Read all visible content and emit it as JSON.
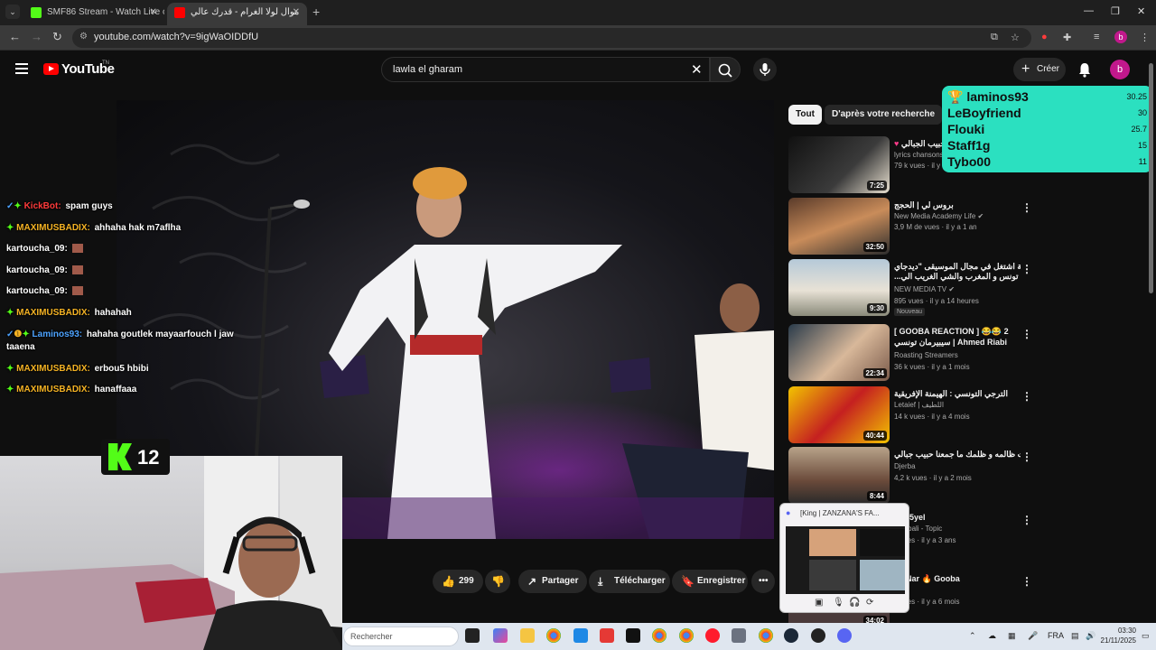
{
  "browser": {
    "tabs": [
      {
        "title": "SMF86 Stream - Watch Live on",
        "active": false
      },
      {
        "title": "موال لولا الغرام - قدرك عالي",
        "active": true
      }
    ],
    "url": "youtube.com/watch?v=9igWaOIDDfU",
    "profile_initial": "b"
  },
  "youtube": {
    "logo_text": "YouTube",
    "logo_tm": "TN",
    "search_query": "lawla el gharam",
    "create_label": "Créer",
    "avatar_initial": "b",
    "chips": [
      "Tout",
      "D'après votre recherche"
    ],
    "actions": {
      "likes": "299",
      "share": "Partager",
      "download": "Télécharger",
      "save": "Enregistrer"
    }
  },
  "chat": {
    "messages": [
      {
        "user": "KickBot:",
        "text": "spam guys",
        "color": "#ff3b3b"
      },
      {
        "user": "MAXIMUSBADIX:",
        "text": "ahhaha hak m7aflha",
        "color": "#f5b324"
      },
      {
        "user": "kartoucha_09:",
        "text": "",
        "color": "#ffffff"
      },
      {
        "user": "kartoucha_09:",
        "text": "",
        "color": "#ffffff"
      },
      {
        "user": "kartoucha_09:",
        "text": "",
        "color": "#ffffff"
      },
      {
        "user": "MAXIMUSBADIX:",
        "text": "hahahah",
        "color": "#f5b324"
      },
      {
        "user": "Laminos93:",
        "text": "hahaha goutlek mayaarfouch l jaw",
        "text2": "taaena",
        "color": "#4da3ff"
      },
      {
        "user": "MAXIMUSBADIX:",
        "text": "erbou5 hbibi",
        "color": "#f5b324"
      },
      {
        "user": "MAXIMUSBADIX:",
        "text": "hanaffaaa",
        "color": "#f5b324"
      }
    ],
    "viewer_count": "12"
  },
  "leaderboard": [
    {
      "name": "laminos93",
      "score": "30.25"
    },
    {
      "name": "LeBoyfriend",
      "score": "30"
    },
    {
      "name": "Flouki",
      "score": "25.7"
    },
    {
      "name": "Staff1g",
      "score": "15"
    },
    {
      "name": "Tybo00",
      "score": "11"
    }
  ],
  "recommendations": [
    {
      "title": "حبيب الجبالي",
      "channel": "lyrics chansons",
      "meta": "79 k vues · il y",
      "duration": "7:25"
    },
    {
      "title": "بروس لي | الحجج",
      "channel": "New Media Academy Life",
      "meta": "3,9 M de vues · il y a 1 an",
      "duration": "32:50"
    },
    {
      "title": "جزائرية اشتغل في مجال الموسيقى \"ديدجاي\"",
      "title2": "...عملت في تونس و المغرب والشي الغريب الي",
      "channel": "NEW MEDIA TV",
      "meta": "895 vues · il y a 14 heures",
      "badge": "Nouveau",
      "duration": "9:30"
    },
    {
      "title": "[ GOOBA REACTION ] 😂😂 2",
      "title2": "سيبيرمان تونسي | Ahmed Riabi",
      "channel": "Roasting Streamers",
      "meta": "36 k vues · il y a 1 mois",
      "duration": "22:34"
    },
    {
      "title": "الترجي التونسي : الهيمنة الإفريقية",
      "channel": "Letaief | اللطيف",
      "meta": "14 k vues · il y a 4 mois",
      "duration": "40:44"
    },
    {
      "title": "أنت ظالمه و ظلمك ما جمعنا حبيب جبالي",
      "channel": "Djerba",
      "meta": "4,2 k vues · il y a 2 mois",
      "duration": "8:44"
    },
    {
      "title": "Rat 5yel",
      "channel": "b Jebali - Topic",
      "meta": "k vues · il y a 3 ans",
      "duration": ""
    },
    {
      "title": "ch Nar 🔥 Gooba",
      "channel": "th",
      "meta": "k vues · il y a 6 mois",
      "duration": "34:02"
    }
  ],
  "popup": {
    "title": "[King | ZANZANA'S FA..."
  },
  "taskbar": {
    "search_placeholder": "Rechercher",
    "language": "FRA",
    "time": "03:30",
    "date": "21/11/2025"
  }
}
